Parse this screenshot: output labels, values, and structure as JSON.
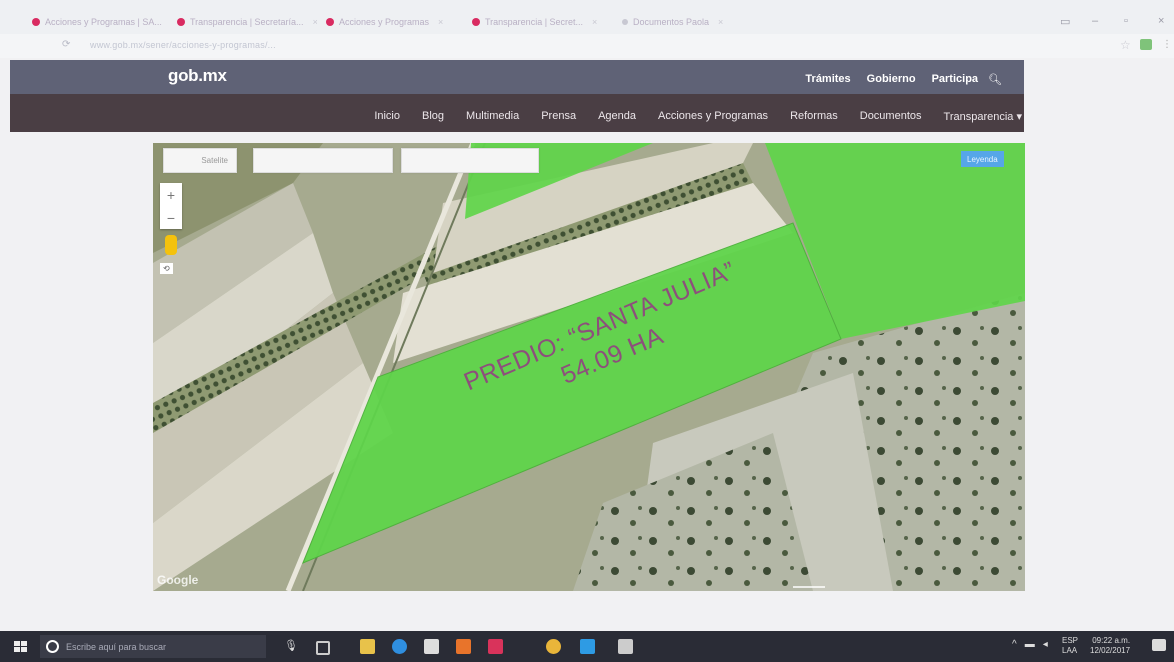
{
  "browser": {
    "tabs": [
      {
        "label": "Acciones y Programas | SA..."
      },
      {
        "label": "Transparencia | Secretaría..."
      },
      {
        "label": "Acciones y Programas"
      },
      {
        "label": "Transparencia | Secret..."
      },
      {
        "label": "Documentos Paola"
      }
    ],
    "address": "www.gob.mx/sener/acciones-y-programas/..."
  },
  "site": {
    "logo": "gob.mx",
    "top_links": [
      "Trámites",
      "Gobierno",
      "Participa"
    ],
    "nav": [
      "Inicio",
      "Blog",
      "Multimedia",
      "Prensa",
      "Agenda",
      "Acciones y Programas",
      "Reformas",
      "Documentos",
      "Transparencia"
    ]
  },
  "map": {
    "satellite_label": "Satelite",
    "legend_label": "Leyenda",
    "parcel_line1": "PREDIO: “SANTA JULIA”",
    "parcel_line2": "54.09 HA",
    "provider": "Google",
    "parcel_color": "#5fd54a"
  },
  "taskbar": {
    "search_placeholder": "Escribe aquí para buscar",
    "lang_line1": "ESP",
    "lang_line2": "LAA",
    "time": "09:22 a.m.",
    "date": "12/02/2017"
  }
}
